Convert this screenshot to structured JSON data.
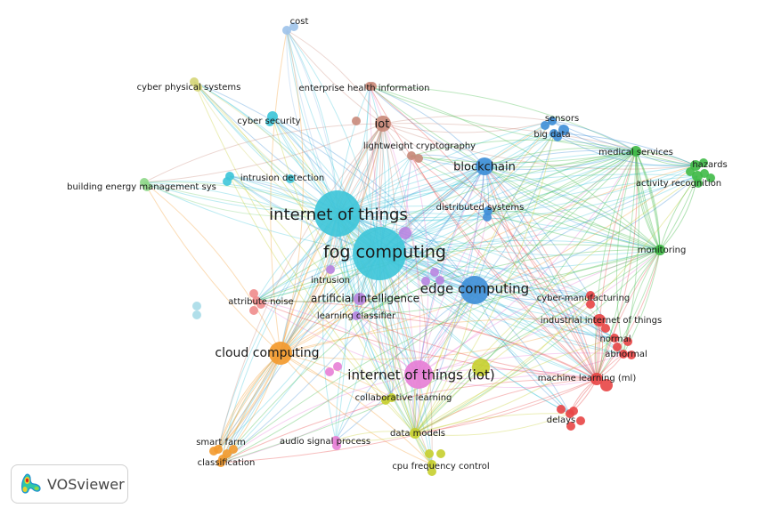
{
  "app": {
    "name": "VOSviewer"
  },
  "cluster_colors": {
    "cyan": "#3fc6d9",
    "blue": "#3f8fd8",
    "green": "#3fba47",
    "red": "#e84545",
    "orange": "#f39a2e",
    "pink": "#e77fd6",
    "yellow": "#c6cf2e",
    "purple": "#b784e0",
    "brown": "#c98a7a",
    "lightblue": "#9ec3ea",
    "olive": "#d6d67a",
    "lightgreen": "#8fd88a",
    "salmon": "#f08c8c",
    "paleblue": "#a9dbe8"
  },
  "nodes": [
    {
      "id": "cost",
      "label": "cost",
      "cluster": "lightblue",
      "weight": 1
    },
    {
      "id": "cyber-physical-systems",
      "label": "cyber physical systems",
      "cluster": "olive",
      "weight": 1
    },
    {
      "id": "enterprise-health-information",
      "label": "enterprise health information",
      "cluster": "brown",
      "weight": 1
    },
    {
      "id": "iot",
      "label": "iot",
      "cluster": "brown",
      "weight": 3
    },
    {
      "id": "cyber-security",
      "label": "cyber security",
      "cluster": "cyan",
      "weight": 1
    },
    {
      "id": "lightweight-cryptography",
      "label": "lightweight cryptography",
      "cluster": "brown",
      "weight": 1
    },
    {
      "id": "sensors",
      "label": "sensors",
      "cluster": "blue",
      "weight": 1
    },
    {
      "id": "big-data",
      "label": "big data",
      "cluster": "blue",
      "weight": 1
    },
    {
      "id": "medical-services",
      "label": "medical services",
      "cluster": "green",
      "weight": 1
    },
    {
      "id": "hazards",
      "label": "hazards",
      "cluster": "green",
      "weight": 1
    },
    {
      "id": "activity-recognition",
      "label": "activity recognition",
      "cluster": "green",
      "weight": 1
    },
    {
      "id": "blockchain",
      "label": "blockchain",
      "cluster": "blue",
      "weight": 3
    },
    {
      "id": "building-energy-management-sys",
      "label": "building energy management sys",
      "cluster": "lightgreen",
      "weight": 1
    },
    {
      "id": "intrusion-detection",
      "label": "intrusion detection",
      "cluster": "cyan",
      "weight": 1
    },
    {
      "id": "distributed-systems",
      "label": "distributed systems",
      "cluster": "blue",
      "weight": 1
    },
    {
      "id": "internet-of-things",
      "label": "internet of things",
      "cluster": "cyan",
      "weight": 8
    },
    {
      "id": "fog-computing",
      "label": "fog computing",
      "cluster": "cyan",
      "weight": 10
    },
    {
      "id": "monitoring",
      "label": "monitoring",
      "cluster": "green",
      "weight": 1
    },
    {
      "id": "intrusion",
      "label": "intrusion",
      "cluster": "purple",
      "weight": 1
    },
    {
      "id": "edge-computing",
      "label": "edge computing",
      "cluster": "blue",
      "weight": 5
    },
    {
      "id": "attribute-noise",
      "label": "attribute noise",
      "cluster": "salmon",
      "weight": 1
    },
    {
      "id": "artificial-intelligence",
      "label": "artificial intelligence",
      "cluster": "purple",
      "weight": 2
    },
    {
      "id": "cyber-manufacturing",
      "label": "cyber-manufacturing",
      "cluster": "red",
      "weight": 1
    },
    {
      "id": "learning-classifier",
      "label": "learning classifier",
      "cluster": "purple",
      "weight": 1
    },
    {
      "id": "industrial-internet-of-things",
      "label": "industrial internet of things",
      "cluster": "red",
      "weight": 2
    },
    {
      "id": "normal",
      "label": "normal",
      "cluster": "red",
      "weight": 1
    },
    {
      "id": "abnormal",
      "label": "abnormal",
      "cluster": "red",
      "weight": 1
    },
    {
      "id": "cloud-computing",
      "label": "cloud computing",
      "cluster": "orange",
      "weight": 5
    },
    {
      "id": "internet-of-things-iot",
      "label": "internet of things (iot)",
      "cluster": "pink",
      "weight": 5
    },
    {
      "id": "machine-learning-ml",
      "label": "machine learning (ml)",
      "cluster": "red",
      "weight": 2
    },
    {
      "id": "collaborative-learning",
      "label": "collaborative learning",
      "cluster": "yellow",
      "weight": 1
    },
    {
      "id": "delays",
      "label": "delays",
      "cluster": "red",
      "weight": 1
    },
    {
      "id": "data-models",
      "label": "data models",
      "cluster": "yellow",
      "weight": 2
    },
    {
      "id": "smart-farm",
      "label": "smart farm",
      "cluster": "orange",
      "weight": 1
    },
    {
      "id": "audio-signal-process",
      "label": "audio signal process",
      "cluster": "pink",
      "weight": 1
    },
    {
      "id": "classification",
      "label": "classification",
      "cluster": "orange",
      "weight": 1
    },
    {
      "id": "cpu-frequency-control",
      "label": "cpu frequency control",
      "cluster": "yellow",
      "weight": 1
    }
  ]
}
